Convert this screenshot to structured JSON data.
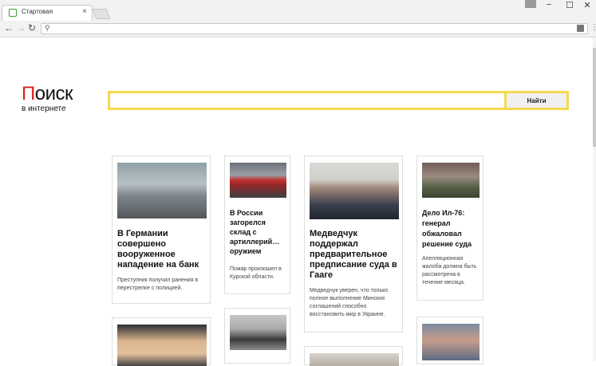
{
  "browser": {
    "tab_title": "Стартовая",
    "tab_close": "×",
    "window_min": "−",
    "window_max": "☐",
    "window_close": "✕",
    "nav_back": "←",
    "nav_forward": "→",
    "nav_reload": "↻",
    "omnibox_value": "",
    "search_glyph": "⚲",
    "menu_glyph": "⋮"
  },
  "logo": {
    "first_letter": "П",
    "rest": "оиск",
    "subtitle": "в интернете"
  },
  "search": {
    "query": "",
    "button_label": "Найти"
  },
  "news": [
    {
      "title": "В Германии совершено вооруженное нападение на банк",
      "description": "Преступник получил ранения в перестрелке с полицией."
    },
    {
      "title": "В России загорелся склад с артиллерий… оружием",
      "description": "Пожар произошел в Курской области."
    },
    {
      "title": "Медведчук поддержал предварительное предписание суда в Гааге",
      "description": "Медведчук уверен, что только полное выполнение Минских соглашений способно восстановить мир в Украине."
    },
    {
      "title": "Дело Ил-76: генерал обжаловал решение суда",
      "description": "Апелляционная жалоба должна быть рассмотрена в течение месяца."
    }
  ]
}
